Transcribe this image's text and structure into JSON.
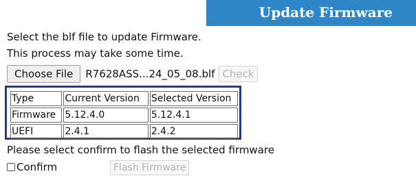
{
  "header": {
    "title": "Update Firmware",
    "bg_color": "#2e86c9"
  },
  "instructions": {
    "line1": "Select the blf file to update Firmware.",
    "line2": "This process may take some time."
  },
  "file": {
    "choose_label": "Choose File",
    "file_name": "R7628ASS...24_05_08.blf",
    "check_label": "Check"
  },
  "table": {
    "headers": [
      "Type",
      "Current Version",
      "Selected Version"
    ],
    "rows": [
      [
        "Firmware",
        "5.12.4.0",
        "5.12.4.1"
      ],
      [
        "UEFI",
        "2.4.1",
        "2.4.2"
      ]
    ],
    "highlight_color": "#1f3f8c"
  },
  "confirm": {
    "prompt": "Please select confirm to flash the selected firmware",
    "checkbox_label": "Confirm",
    "checked": false,
    "flash_label": "Flash Firmware"
  }
}
